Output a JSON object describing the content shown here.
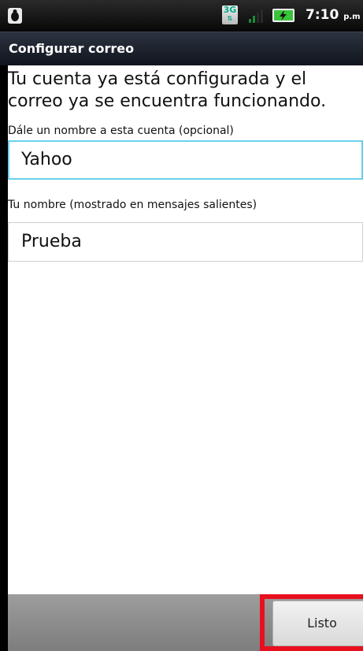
{
  "status_bar": {
    "network_type": "3G",
    "time": "7:10",
    "ampm": "p.m",
    "icons": [
      "bug-icon",
      "3g-icon",
      "signal-icon",
      "battery-charging-icon"
    ]
  },
  "app_bar": {
    "title": "Configurar correo"
  },
  "content": {
    "message": "Tu cuenta ya está configurada y el correo ya se encuentra funcionando.",
    "account_name": {
      "label": "Dále un nombre a esta cuenta (opcional)",
      "value": "Yahoo"
    },
    "your_name": {
      "label": "Tu nombre (mostrado en mensajes salientes)",
      "value": "Prueba"
    }
  },
  "bottom_bar": {
    "done_label": "Listo"
  },
  "colors": {
    "focus_border": "#6ad1ec",
    "highlight_box": "#e8101e"
  }
}
